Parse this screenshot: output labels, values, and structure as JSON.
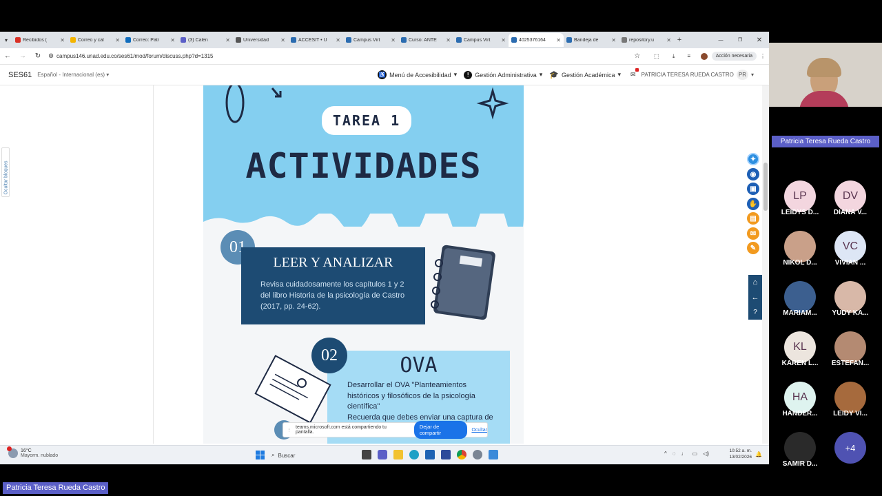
{
  "browser": {
    "tabs": [
      {
        "label": "Recibidos (",
        "color": "#d93025"
      },
      {
        "label": "Correo y cal",
        "color": "#f4b400"
      },
      {
        "label": "Correo: Patr",
        "color": "#0f6cbd"
      },
      {
        "label": "(3) Calen",
        "color": "#5b5fc7"
      },
      {
        "label": "Universidad",
        "color": "#555555"
      },
      {
        "label": "ACCESIT • U",
        "color": "#2b6cb0"
      },
      {
        "label": "Campus Virt",
        "color": "#2b6cb0"
      },
      {
        "label": "Curso: ANTE",
        "color": "#2b6cb0"
      },
      {
        "label": "Campus Virt",
        "color": "#2b6cb0"
      },
      {
        "label": "4025376164",
        "color": "#2b6cb0"
      },
      {
        "label": "Bandeja de",
        "color": "#2b6cb0"
      },
      {
        "label": "repository.u",
        "color": "#777777"
      }
    ],
    "url": "campus146.unad.edu.co/ses61/mod/forum/discuss.php?d=1315",
    "action_button": "Acción necesaria"
  },
  "site": {
    "brand": "SES61",
    "language": "Español - Internacional (es)",
    "accessibility_menu": "Menú de Accesibilidad",
    "admin_menu": "Gestión Administrativa",
    "academic_menu": "Gestión Académica",
    "user_name": "PATRICIA TERESA RUEDA CASTRO",
    "user_initials": "PR",
    "hide_blocks": "Ocultar bloques"
  },
  "infographic": {
    "badge": "TAREA 1",
    "title": "ACTIVIDADES",
    "step1_number": "01",
    "step1_title": "LEER Y ANALIZAR",
    "step1_text_1": "Revisa cuidadosamente los capítulos 1 y 2",
    "step1_text_2": "del libro Historia de la psicología de Castro",
    "step1_text_3": "(2017, pp. 24-62).",
    "step2_number": "02",
    "step2_title": "OVA",
    "step2_text_1": "Desarrollar el OVA \"Planteamientos",
    "step2_text_2": "históricos y filosóficos de la psicología",
    "step2_text_3": "científica\"",
    "step2_text_4": "Recuerda que debes enviar una captura de"
  },
  "sharebar": {
    "message": "teams.microsoft.com está compartiendo tu pantalla.",
    "stop_button": "Dejar de compartir",
    "hide_link": "Ocultar"
  },
  "taskbar": {
    "temperature": "16°C",
    "weather": "Mayorm. nublado",
    "search_placeholder": "Buscar",
    "time": "10:52 a. m.",
    "date": "13/02/2026"
  },
  "meeting": {
    "presenter_name": "Patricia Teresa Rueda Castro",
    "bottom_name": "Patricia Teresa Rueda Castro",
    "participants": [
      {
        "initials": "LP",
        "name": "LEIDYS D...",
        "color": "#f3d6df"
      },
      {
        "initials": "DV",
        "name": "DIANA V...",
        "color": "#f3d6df"
      },
      {
        "initials": "",
        "name": "NIKOL D...",
        "color": "#c9a089"
      },
      {
        "initials": "VC",
        "name": "VIVIAN ...",
        "color": "#dde6f5"
      },
      {
        "initials": "",
        "name": "MARIAM...",
        "color": "#3c5f8f"
      },
      {
        "initials": "",
        "name": "YUDY KA...",
        "color": "#d8b8a8"
      },
      {
        "initials": "KL",
        "name": "KAREN L...",
        "color": "#ece5de"
      },
      {
        "initials": "",
        "name": "ESTEFAN...",
        "color": "#b48a72"
      },
      {
        "initials": "HA",
        "name": "HANDER...",
        "color": "#def3ef"
      },
      {
        "initials": "",
        "name": "LEIDY VI...",
        "color": "#a66a3d"
      },
      {
        "initials": "",
        "name": "SAMIR D...",
        "color": "#2a2a2a"
      }
    ],
    "more_count": "+4"
  }
}
